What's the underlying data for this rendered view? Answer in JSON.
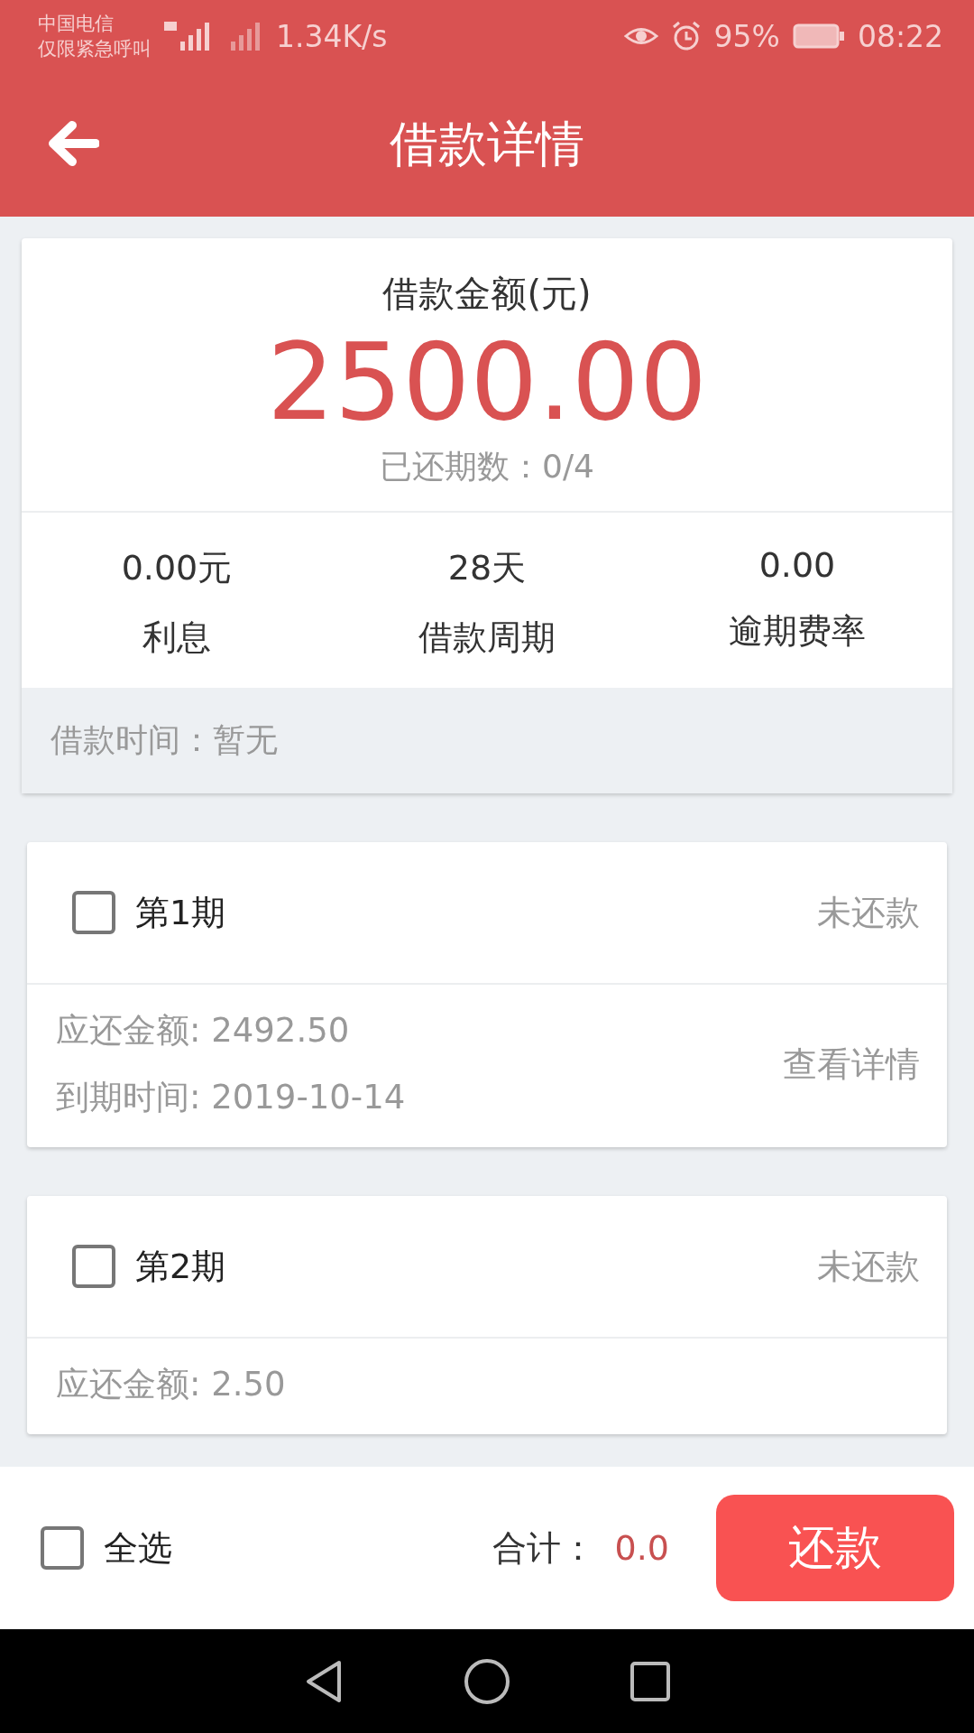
{
  "status_bar": {
    "carrier": "中国电信",
    "carrier_note": "仅限紧急呼叫",
    "network_speed": "1.34K/s",
    "battery": "95%",
    "time": "08:22"
  },
  "header": {
    "title": "借款详情"
  },
  "summary": {
    "label": "借款金额(元)",
    "amount": "2500.00",
    "repaid_periods": "已还期数：0/4",
    "stats": [
      {
        "value": "0.00元",
        "label": "利息"
      },
      {
        "value": "28天",
        "label": "借款周期"
      },
      {
        "value": "0.00",
        "label": "逾期费率"
      }
    ],
    "loan_time": "借款时间：暂无"
  },
  "periods": [
    {
      "title": "第1期",
      "status": "未还款",
      "checked": false,
      "amount": "应还金额: 2492.50",
      "due_date": "到期时间: 2019-10-14",
      "detail_link": "查看详情"
    },
    {
      "title": "第2期",
      "status": "未还款",
      "checked": false,
      "amount": "应还金额: 2.50"
    }
  ],
  "footer": {
    "select_all": {
      "label": "全选",
      "checked": false
    },
    "total_label": "合计：",
    "total": "0.0",
    "pay_button": "还款"
  }
}
